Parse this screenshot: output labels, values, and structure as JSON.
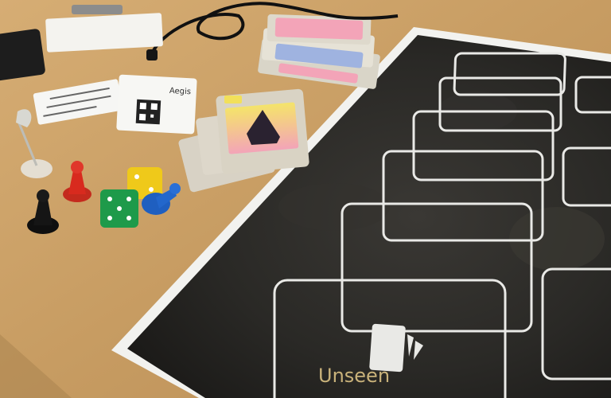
{
  "scene": {
    "description_free": true
  },
  "board": {
    "label": "Unseen"
  },
  "card_box": {
    "brand": "Aegis"
  },
  "colors": {
    "table": "#c9a068",
    "table_light": "#d9b27a",
    "mat": "#1e1d1b",
    "mat_border": "#f2f2ef",
    "slot_outline": "#e9e9e6",
    "label_gold": "#c9b27a",
    "red_pawn": "#d82a1e",
    "blue_pawn": "#1f5fc0",
    "black_pawn": "#151515",
    "green_die": "#1e9a4a",
    "yellow_die": "#f2cc14",
    "card_pink": "#f3a3b6",
    "card_yellow": "#f3e25a"
  }
}
